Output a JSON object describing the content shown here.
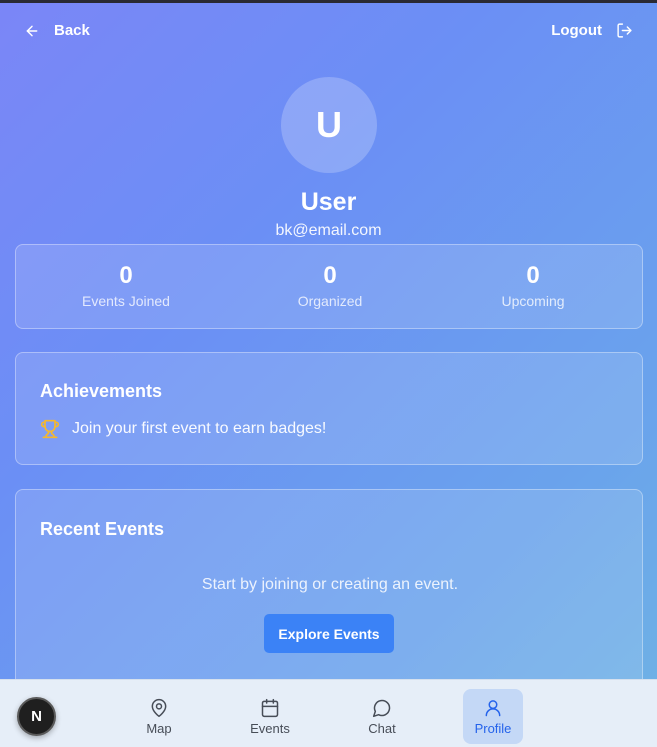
{
  "header": {
    "back_label": "Back",
    "logout_label": "Logout"
  },
  "profile": {
    "initial": "U",
    "name": "User",
    "email": "bk@email.com"
  },
  "stats": [
    {
      "value": "0",
      "label": "Events Joined"
    },
    {
      "value": "0",
      "label": "Organized"
    },
    {
      "value": "0",
      "label": "Upcoming"
    }
  ],
  "achievements": {
    "title": "Achievements",
    "empty_text": "Join your first event to earn badges!",
    "icon": "trophy-icon",
    "icon_color": "#f5b82e"
  },
  "recent_events": {
    "title": "Recent Events",
    "empty_text": "Start by joining or creating an event.",
    "button_label": "Explore Events",
    "button_color": "#3b82f6"
  },
  "nav": {
    "badge": "N",
    "tabs": [
      {
        "label": "Map",
        "icon": "map-pin-icon"
      },
      {
        "label": "Events",
        "icon": "calendar-icon"
      },
      {
        "label": "Chat",
        "icon": "chat-bubble-icon"
      },
      {
        "label": "Profile",
        "icon": "user-icon",
        "active": true
      }
    ],
    "active_color": "#2563eb"
  }
}
